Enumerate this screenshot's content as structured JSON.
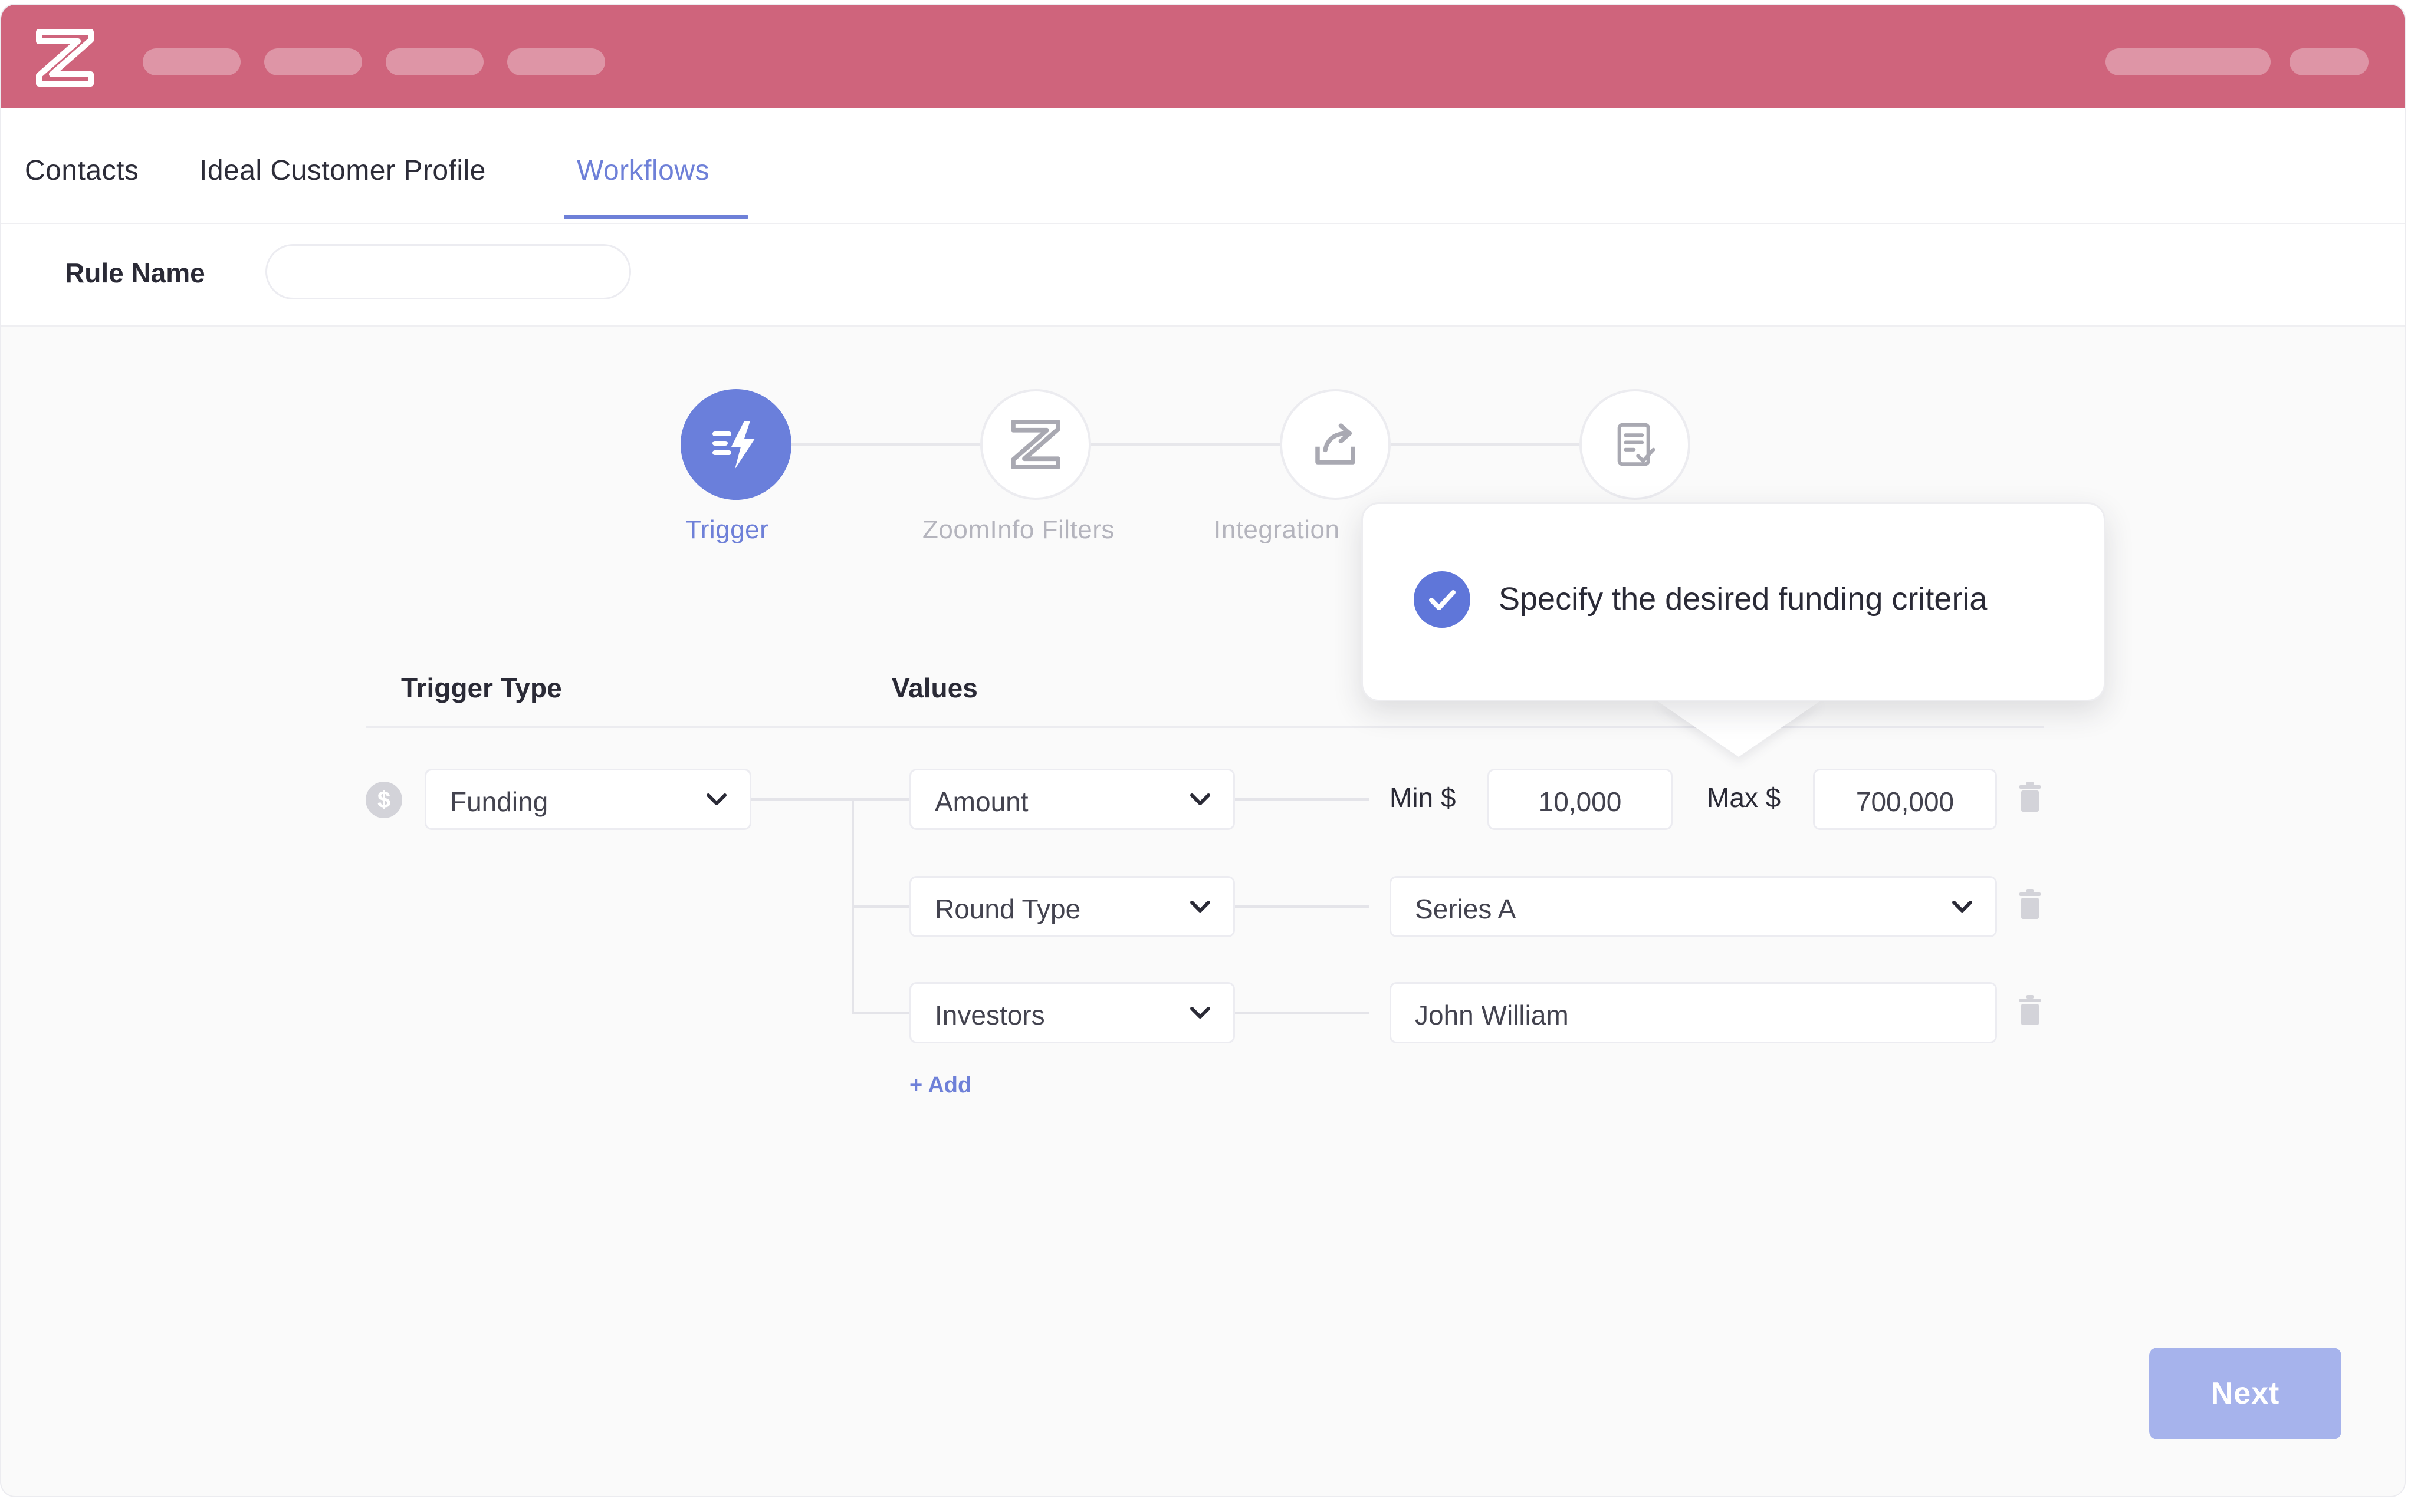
{
  "app": {
    "logo_icon": "zoominfo-z-logo",
    "brand_color": "#cf647c",
    "accent_color": "#6e80d8"
  },
  "tabs": [
    {
      "label": "Contacts",
      "active": false
    },
    {
      "label": "Ideal Customer Profile",
      "active": false
    },
    {
      "label": "Workflows",
      "active": true
    }
  ],
  "rule": {
    "label": "Rule Name",
    "value": "",
    "placeholder": ""
  },
  "steps": [
    {
      "label": "Trigger",
      "icon": "lightning-icon",
      "active": true
    },
    {
      "label": "ZoomInfo Filters",
      "icon": "zoominfo-z-icon",
      "active": false
    },
    {
      "label": "Integration",
      "icon": "export-icon",
      "active": false
    },
    {
      "label": "",
      "icon": "document-check-icon",
      "active": false
    }
  ],
  "table": {
    "trigger_type_header": "Trigger Type",
    "values_header": "Values",
    "trigger_type_value": "Funding",
    "rows": [
      {
        "field": "Amount",
        "min_label": "Min $",
        "min_value": "10,000",
        "max_label": "Max $",
        "max_value": "700,000"
      },
      {
        "field": "Round Type",
        "value": "Series A"
      },
      {
        "field": "Investors",
        "value": "John William"
      }
    ],
    "add_label": "Add"
  },
  "tooltip": {
    "text": "Specify the desired funding criteria",
    "icon": "check-circle-icon"
  },
  "next_label": "Next"
}
